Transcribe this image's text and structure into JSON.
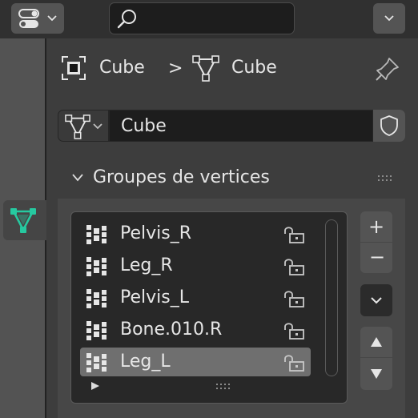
{
  "header": {
    "editor_type_icon": "properties-editor-icon",
    "search": {
      "value": "",
      "placeholder": "",
      "icon": "search-icon"
    },
    "dropdown_icon": "chevron-down-icon"
  },
  "breadcrumb": {
    "object_icon": "object-cube-icon",
    "object_name": "Cube",
    "separator": ">",
    "mesh_icon": "mesh-data-icon",
    "mesh_name": "Cube",
    "pin_icon": "pin-icon"
  },
  "tabs": [
    {
      "name": "vertex-data",
      "icon": "vertex-data-icon",
      "active": true,
      "color": "#26c9a0"
    }
  ],
  "mesh_datablock": {
    "type_icon": "mesh-data-icon",
    "name": "Cube",
    "fake_user_icon": "shield-icon"
  },
  "vertex_groups_panel": {
    "title": "Groupes de vertices",
    "expanded": true,
    "groups": [
      {
        "name": "Pelvis_R",
        "active": false,
        "locked": false
      },
      {
        "name": "Leg_R",
        "active": false,
        "locked": false
      },
      {
        "name": "Pelvis_L",
        "active": false,
        "locked": false
      },
      {
        "name": "Bone.010.R",
        "active": false,
        "locked": false
      },
      {
        "name": "Leg_L",
        "active": true,
        "locked": false
      }
    ],
    "side_buttons": {
      "add": "+",
      "remove": "−",
      "specials_icon": "chevron-down-icon",
      "move_up_icon": "triangle-up-icon",
      "move_down_icon": "triangle-down-icon"
    }
  },
  "colors": {
    "accent": "#26c9a0",
    "active_row": "#6f6f6f",
    "field_bg": "#1d1d1d",
    "button_bg": "#545454"
  }
}
